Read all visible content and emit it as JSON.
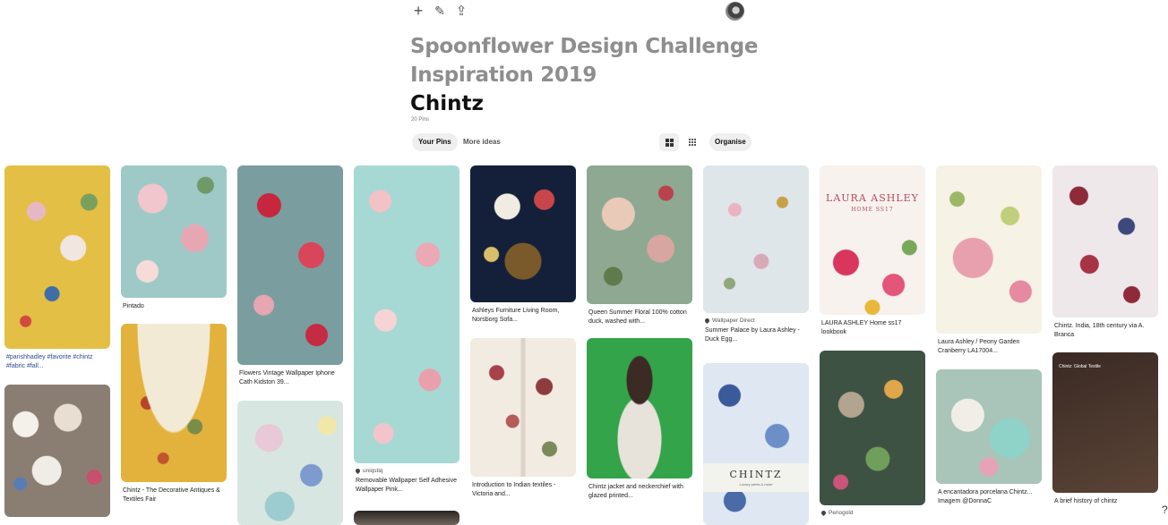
{
  "toolbar": {
    "add_icon": "plus-icon",
    "edit_icon": "pencil-icon",
    "share_icon": "share-upload-icon",
    "add_symbol": "+",
    "edit_symbol": "✎",
    "share_symbol": "⇪"
  },
  "board": {
    "title": "Spoonflower Design Challenge Inspiration 2019",
    "section": "Chintz",
    "pin_count": "20 Pins"
  },
  "tabs": {
    "your_pins": "Your Pins",
    "more_ideas": "More ideas"
  },
  "view": {
    "organise": "Organise"
  },
  "pins": {
    "p1": {
      "caption": "#parishhadley #favorite #chintz #fabric #fall..."
    },
    "p2": {
      "caption": "Pintado"
    },
    "p3": {
      "caption": "Flowers Vintage Wallpaper Iphone Cath Kidston 39..."
    },
    "p4": {
      "source": "uniqstiq",
      "caption": "Removable Wallpaper Self Adhesive Wallpaper Pink..."
    },
    "p5": {
      "caption": "Ashleys Furniture Living Room, Norsborg Sofa..."
    },
    "p6": {
      "caption": "Queen Summer Floral 100% cotton duck, washed with..."
    },
    "p7": {
      "source": "Wallpaper Direct",
      "caption": "Summer Palace by Laura Ashley - Duck Egg..."
    },
    "p8": {
      "caption": "LAURA ASHLEY Home ss17 lookbook",
      "overlay_line1": "LAURA ASHLEY",
      "overlay_line2": "HOME SS17"
    },
    "p9": {
      "caption": "Laura Ashley / Peony Garden Cranberry LA17004..."
    },
    "p10": {
      "caption": "Chintz. India, 18th century via A. Branca"
    },
    "p11": {
      "caption": "Chintz - The Decorative Antiques & Textiles Fair"
    },
    "p12": {
      "caption": "Introduction to Indian textiles - Victoria and..."
    },
    "p13": {
      "caption": "Chintz jacket and neckerchief with glazed printed..."
    },
    "p14": {
      "overlay_title": "CHINTZ",
      "overlay_sub": "Luxury prints & more"
    },
    "p15": {
      "source": "Periogold"
    },
    "p16": {
      "caption": "A encantadora porcelana Chintz... Imagem @DonnaC"
    },
    "p17": {
      "caption": "A brief history of chintz",
      "overlay_heading": "Chintz: Global Textile"
    }
  },
  "help": "?"
}
